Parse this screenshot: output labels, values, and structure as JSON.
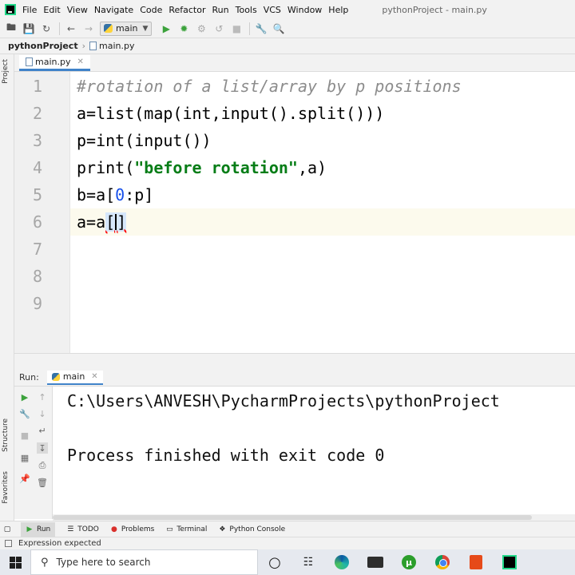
{
  "menubar": {
    "items": [
      "File",
      "Edit",
      "View",
      "Navigate",
      "Code",
      "Refactor",
      "Run",
      "Tools",
      "VCS",
      "Window",
      "Help"
    ],
    "window_title": "pythonProject - main.py"
  },
  "toolbar": {
    "run_config": "main"
  },
  "navbar": {
    "project": "pythonProject",
    "file": "main.py"
  },
  "side_labels": {
    "project": "Project",
    "structure": "Structure",
    "favorites": "Favorites"
  },
  "editor": {
    "tab_label": "main.py",
    "line_numbers": [
      "1",
      "2",
      "3",
      "4",
      "5",
      "6",
      "7",
      "8",
      "9"
    ],
    "line1": "#rotation of a list/array by p positions",
    "line2": "a=list(map(int,input().split()))",
    "line3": "p=int(input())",
    "line4_pre": "print(",
    "line4_str": "\"before rotation\"",
    "line4_post": ",a)",
    "line5_pre": "b=a[",
    "line5_num": "0",
    "line5_post": ":p]",
    "line6_pre": "a=a",
    "line6_open": "[",
    "line6_close": "]"
  },
  "run_panel": {
    "label": "Run:",
    "tab": "main",
    "console_path": "C:\\Users\\ANVESH\\PycharmProjects\\pythonProject",
    "console_exit": "Process finished with exit code 0"
  },
  "bottom_tabs": {
    "run": "Run",
    "todo": "TODO",
    "problems": "Problems",
    "terminal": "Terminal",
    "python_console": "Python Console"
  },
  "status": {
    "message": "Expression expected"
  },
  "taskbar": {
    "search_placeholder": "Type here to search"
  },
  "colors": {
    "accent": "#4083c9",
    "comment": "#8c8c8c",
    "string": "#067d17",
    "number": "#1750eb",
    "selection": "#d6e7fb"
  }
}
